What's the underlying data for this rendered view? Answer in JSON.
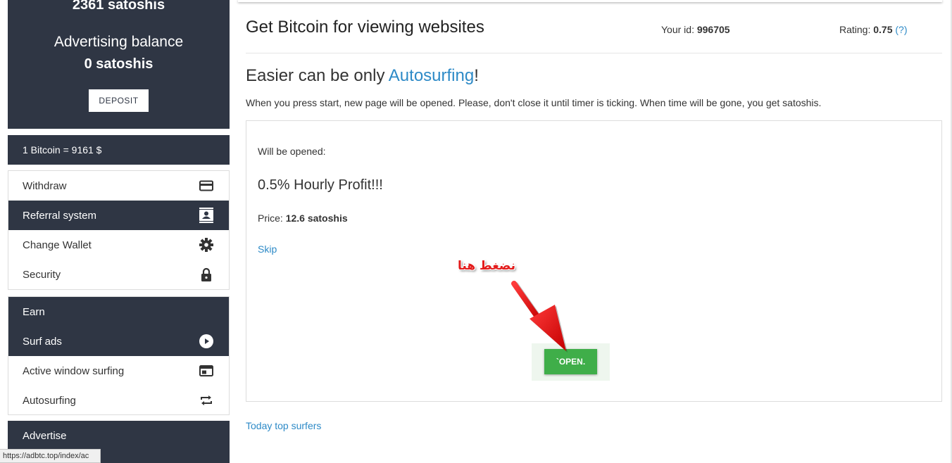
{
  "sidebar": {
    "balance": {
      "satoshis_text": "2361 satoshis",
      "advertising_title": "Advertising balance",
      "advertising_value": "0 satoshis",
      "deposit_label": "DEPOSIT"
    },
    "rate": "1 Bitcoin = 9161 $",
    "account_items": [
      {
        "label": "Withdraw",
        "icon": "credit-card-icon"
      },
      {
        "label": "Referral system",
        "icon": "contact-card-icon",
        "active": true
      },
      {
        "label": "Change Wallet",
        "icon": "gear-icon"
      },
      {
        "label": "Security",
        "icon": "lock-icon"
      }
    ],
    "earn": {
      "header": "Earn",
      "items": [
        {
          "label": "Surf ads",
          "icon": "play-circle-icon",
          "active": true
        },
        {
          "label": "Active window surfing",
          "icon": "browser-window-icon"
        },
        {
          "label": "Autosurfing",
          "icon": "repeat-icon"
        }
      ]
    },
    "advertise_header": "Advertise"
  },
  "status_bar_url": "https://adbtc.top/index/ac",
  "header": {
    "title": "Get Bitcoin for viewing websites",
    "id_label": "Your id:",
    "id_value": "996705",
    "rating_label": "Rating:",
    "rating_value": "0.75",
    "rating_help": "(?)"
  },
  "autosurf": {
    "prefix": "Easier can be only ",
    "link": "Autosurfing",
    "suffix": "!",
    "description": "When you press start, new page will be opened. Please, don't close it until timer is ticking. When time will be gone, you get satoshis."
  },
  "panel": {
    "will_open_label": "Will be opened:",
    "site_title": "0.5% Hourly Profit!!!",
    "price_label": "Price:",
    "price_value": "12.6 satoshis",
    "skip_label": "Skip",
    "open_label": "`OPEN.",
    "annotation": "نضغط هنا"
  },
  "footer_link": "Today top surfers",
  "colors": {
    "sidebar_dark": "#2f3644",
    "link_blue": "#2d8ac7",
    "open_green": "#3fae49",
    "annotation_red": "#e31b1b"
  }
}
